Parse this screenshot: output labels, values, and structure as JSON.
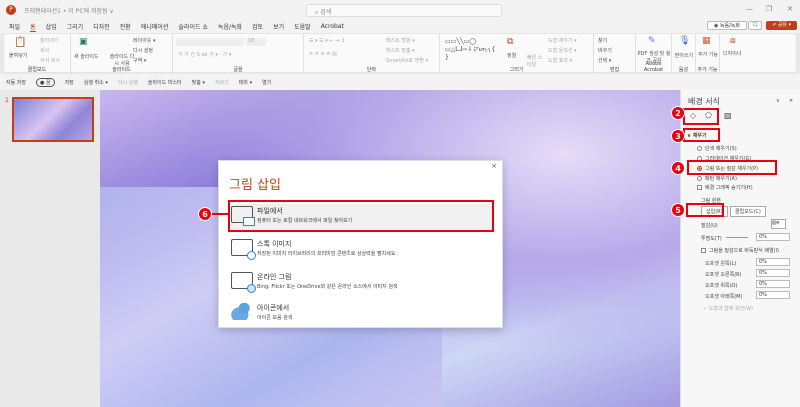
{
  "titlebar": {
    "doc_title": "프레젠테이션1 • 이 PC에 저장됨 ∨",
    "search_placeholder": "검색",
    "minimize": "—",
    "restore": "❐",
    "close": "✕"
  },
  "tabs": [
    "파일",
    "홈",
    "삽입",
    "그리기",
    "디자인",
    "전환",
    "애니메이션",
    "슬라이드 쇼",
    "녹음/녹화",
    "검토",
    "보기",
    "도움말",
    "Acrobat"
  ],
  "active_tab": "홈",
  "header_buttons": {
    "record": "◉ 녹음/녹화",
    "comment": "🗨",
    "share": "⇗ 공유 ▾"
  },
  "ribbon": {
    "clipboard": {
      "label": "클립보드",
      "paste": "붙여넣기",
      "cut": "잘라내기",
      "copy": "복사",
      "format_painter": "서식 복사"
    },
    "slides": {
      "label": "슬라이드",
      "new_slide": "새 슬라이드",
      "reuse": "슬라이드 다시 사용",
      "layout": "레이아웃 ▾",
      "reset": "다시 설정",
      "section": "구역 ▾"
    },
    "font": {
      "label": "글꼴",
      "size": "18"
    },
    "paragraph": {
      "label": "단락",
      "text_direction": "텍스트 방향 ▾",
      "align_text": "텍스트 맞춤 ▾",
      "smartart": "SmartArt로 변환 ▾"
    },
    "drawing": {
      "label": "그리기",
      "arrange": "정렬",
      "quick_styles": "빠른 스타일",
      "shape_fill": "도형 채우기 ▾",
      "shape_outline": "도형 윤곽선 ▾",
      "shape_effects": "도형 효과 ▾"
    },
    "editing": {
      "label": "편집",
      "find": "찾기",
      "replace": "바꾸기",
      "select": "선택 ▾"
    },
    "adobe": {
      "label": "Adobe Acrobat",
      "pdf": "PDF 생성 및 링크 공유"
    },
    "voice": {
      "label": "음성",
      "dictate": "받아쓰기"
    },
    "addins": {
      "label": "추가 기능",
      "addins": "추가 기능"
    },
    "designer": {
      "designer": "디자이너"
    }
  },
  "qat": [
    "자동 저장",
    "● 꿈",
    "저장",
    "실행 취소 ▾",
    "다시 실행",
    "슬라이드 마스터",
    "맞춤 ▾",
    "자르기",
    "테마 ▾",
    "열기"
  ],
  "thumbnail": {
    "number": "1"
  },
  "format_pane": {
    "title": "배경 서식",
    "fill_header": "채우기",
    "options": [
      "단색 채우기(S)",
      "그라데이션 채우기(G)",
      "그림 또는 질감 채우기(P)",
      "패턴 채우기(A)"
    ],
    "selected_option": "그림 또는 질감 채우기(P)",
    "hide_bg": "배경 그래픽 숨기기(H)",
    "picture_source": "그림 원본",
    "insert": "삽입(R)",
    "clipboard": "클립보드(C)",
    "texture": "질감(U)",
    "transparency": "투명도(T)",
    "transparency_value": "0%",
    "tile": "그림을 질감으로 바둑판식 배열(I)",
    "offsets": [
      {
        "label": "오프셋 왼쪽(L)",
        "value": "0%"
      },
      {
        "label": "오프셋 오른쪽(R)",
        "value": "0%"
      },
      {
        "label": "오프셋 위쪽(O)",
        "value": "0%"
      },
      {
        "label": "오프셋 아래쪽(M)",
        "value": "0%"
      }
    ],
    "rotate": "도형과 함께 회전(W)"
  },
  "dialog": {
    "title": "그림 삽입",
    "close": "×",
    "options": [
      {
        "title": "파일에서",
        "desc": "컴퓨터 또는 로컬 네트워크에서 파일 찾아보기"
      },
      {
        "title": "스톡 이미지",
        "desc": "저장된 이미지 라이브러리의 프리미엄 콘텐츠로 상상력을 펼치세요."
      },
      {
        "title": "온라인 그림",
        "desc": "Bing, Flickr 또는 OneDrive와 같은 온라인 소스에서 이미지 검색"
      },
      {
        "title": "아이콘에서",
        "desc": "아이콘 모음 검색"
      }
    ]
  },
  "annotations": [
    "2",
    "3",
    "4",
    "5",
    "6"
  ],
  "colors": {
    "accent": "#c43e1c",
    "highlight": "#e60012"
  }
}
